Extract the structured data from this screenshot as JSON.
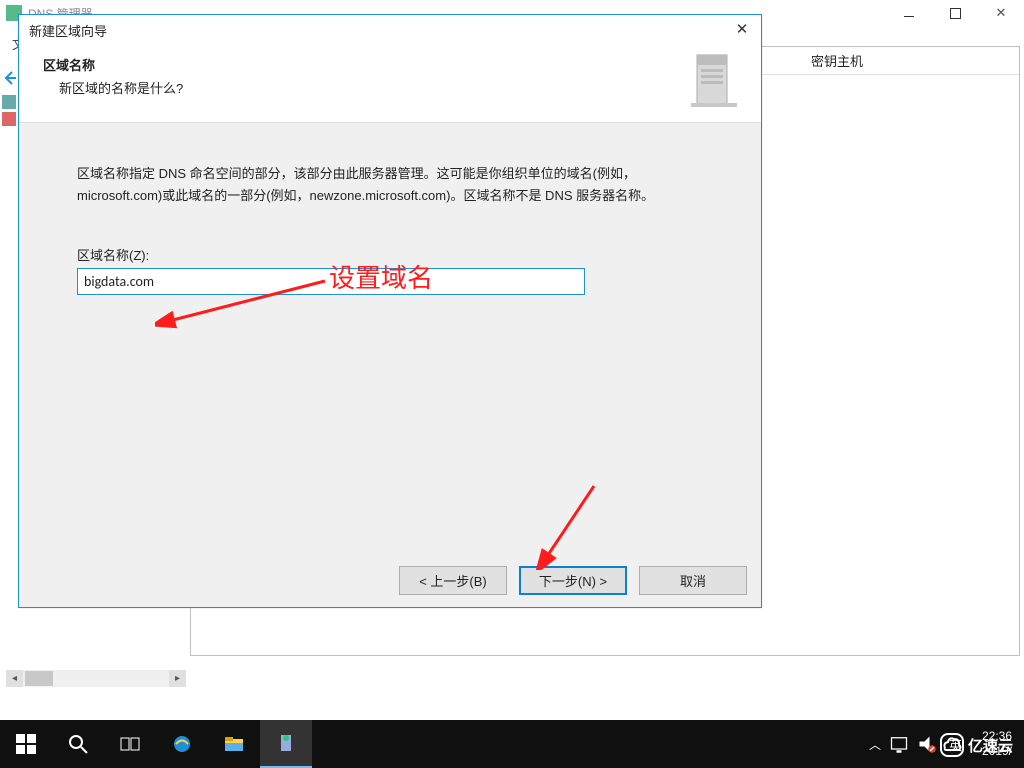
{
  "background_window": {
    "title": "DNS 管理器",
    "menu_file": "文",
    "column_header": "密钥主机"
  },
  "dialog": {
    "title": "新建区域向导",
    "heading": "区域名称",
    "subheading": "新区域的名称是什么?",
    "body_text": "区域名称指定 DNS 命名空间的部分，该部分由此服务器管理。这可能是你组织单位的域名(例如，microsoft.com)或此域名的一部分(例如，newzone.microsoft.com)。区域名称不是 DNS 服务器名称。",
    "field_label": "区域名称(Z):",
    "input_value": "bigdata.com",
    "buttons": {
      "back": "< 上一步(B)",
      "next": "下一步(N) >",
      "cancel": "取消"
    }
  },
  "annotation": {
    "label": "设置域名"
  },
  "taskbar": {
    "ime": "英",
    "time": "22:36",
    "date": "2019/"
  },
  "watermark": {
    "text": "亿速云"
  }
}
